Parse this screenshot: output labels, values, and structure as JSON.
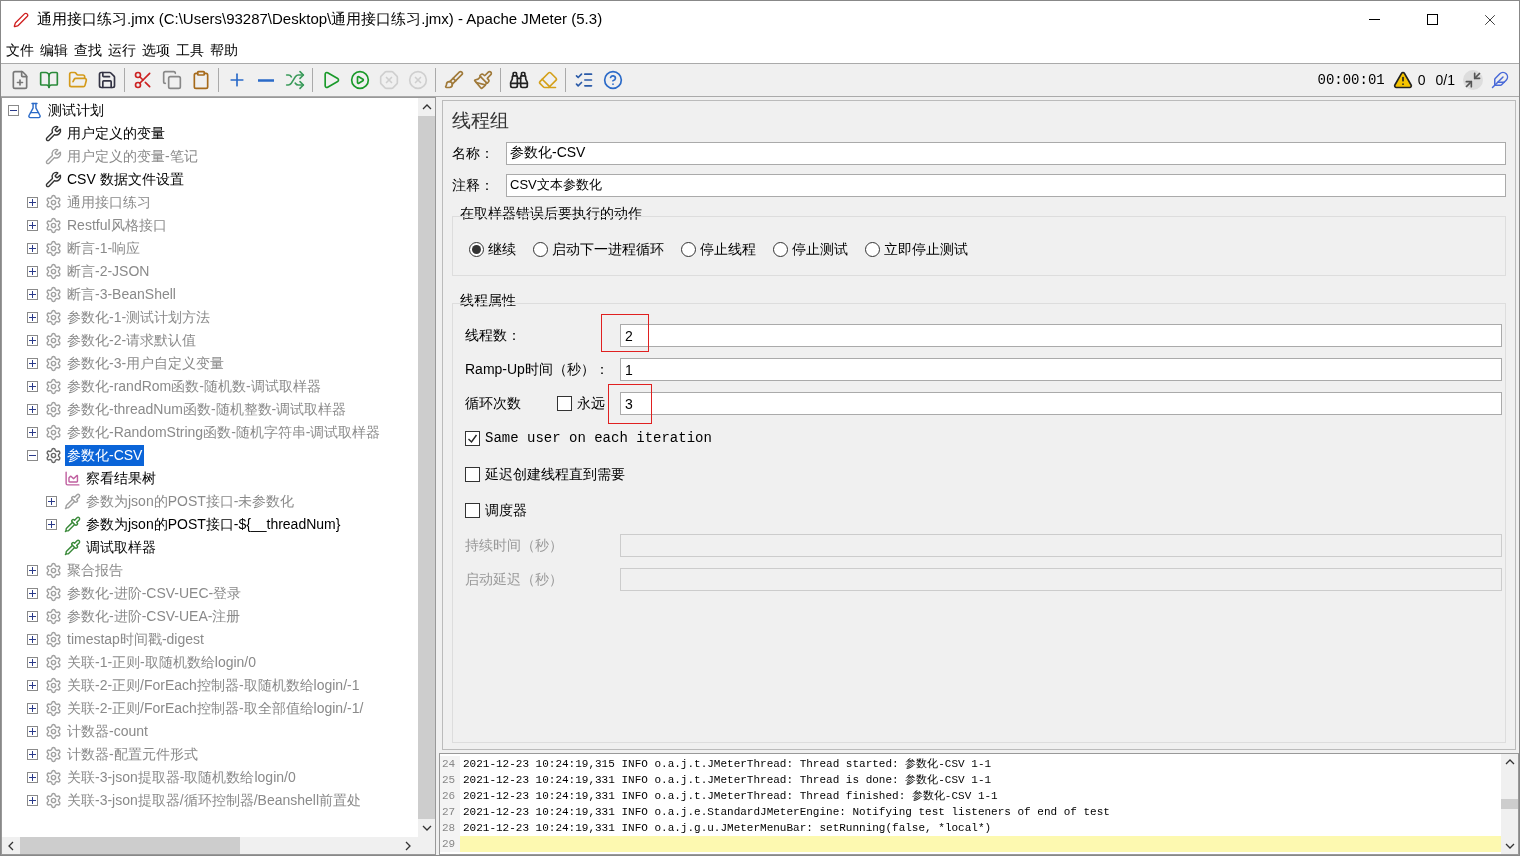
{
  "window": {
    "title": "通用接口练习.jmx (C:\\Users\\93287\\Desktop\\通用接口练习.jmx) - Apache JMeter (5.3)"
  },
  "menu": [
    "文件",
    "编辑",
    "查找",
    "运行",
    "选项",
    "工具",
    "帮助"
  ],
  "toolbar": [
    {
      "kind": "new",
      "disabled": false
    },
    {
      "kind": "templates",
      "disabled": false
    },
    {
      "kind": "open",
      "disabled": false
    },
    {
      "kind": "save",
      "disabled": false
    },
    {
      "kind": "sep"
    },
    {
      "kind": "cut",
      "disabled": false
    },
    {
      "kind": "copy",
      "disabled": false
    },
    {
      "kind": "paste",
      "disabled": false
    },
    {
      "kind": "sep"
    },
    {
      "kind": "expand",
      "disabled": false
    },
    {
      "kind": "collapse",
      "disabled": false
    },
    {
      "kind": "toggle",
      "disabled": false
    },
    {
      "kind": "sep"
    },
    {
      "kind": "start",
      "disabled": false
    },
    {
      "kind": "start-no-pause",
      "disabled": false
    },
    {
      "kind": "stop",
      "disabled": true
    },
    {
      "kind": "shutdown",
      "disabled": true
    },
    {
      "kind": "sep"
    },
    {
      "kind": "clear",
      "disabled": false
    },
    {
      "kind": "clear-all",
      "disabled": false
    },
    {
      "kind": "sep"
    },
    {
      "kind": "search",
      "disabled": false
    },
    {
      "kind": "reset",
      "disabled": false
    },
    {
      "kind": "sep"
    },
    {
      "kind": "functions",
      "disabled": false
    },
    {
      "kind": "help",
      "disabled": false
    }
  ],
  "status": {
    "timer": "00:00:01",
    "warnings": "0",
    "threads": "0/1"
  },
  "tree": [
    {
      "label": "测试计划",
      "kind": "plan",
      "enabled": true,
      "selected": false,
      "expanded": true,
      "children": [
        {
          "label": "用户定义的变量",
          "kind": "config",
          "enabled": true,
          "selected": false
        },
        {
          "label": "用户定义的变量-笔记",
          "kind": "config",
          "enabled": false,
          "selected": false
        },
        {
          "label": "CSV 数据文件设置",
          "kind": "config",
          "enabled": true,
          "selected": false
        },
        {
          "label": "通用接口练习",
          "kind": "threadgroup",
          "enabled": false,
          "selected": false,
          "expanded": false
        },
        {
          "label": "Restful风格接口",
          "kind": "threadgroup",
          "enabled": false,
          "selected": false,
          "expanded": false
        },
        {
          "label": "断言-1-响应",
          "kind": "threadgroup",
          "enabled": false,
          "selected": false,
          "expanded": false
        },
        {
          "label": "断言-2-JSON",
          "kind": "threadgroup",
          "enabled": false,
          "selected": false,
          "expanded": false
        },
        {
          "label": "断言-3-BeanShell",
          "kind": "threadgroup",
          "enabled": false,
          "selected": false,
          "expanded": false
        },
        {
          "label": "参数化-1-测试计划方法",
          "kind": "threadgroup",
          "enabled": false,
          "selected": false,
          "expanded": false
        },
        {
          "label": "参数化-2-请求默认值",
          "kind": "threadgroup",
          "enabled": false,
          "selected": false,
          "expanded": false
        },
        {
          "label": "参数化-3-用户自定义变量",
          "kind": "threadgroup",
          "enabled": false,
          "selected": false,
          "expanded": false
        },
        {
          "label": "参数化-randRom函数-随机数-调试取样器",
          "kind": "threadgroup",
          "enabled": false,
          "selected": false,
          "expanded": false
        },
        {
          "label": "参数化-threadNum函数-随机整数-调试取样器",
          "kind": "threadgroup",
          "enabled": false,
          "selected": false,
          "expanded": false
        },
        {
          "label": "参数化-RandomString函数-随机字符串-调试取样器",
          "kind": "threadgroup",
          "enabled": false,
          "selected": false,
          "expanded": false
        },
        {
          "label": "参数化-CSV",
          "kind": "threadgroup",
          "enabled": true,
          "selected": true,
          "expanded": true,
          "children": [
            {
              "label": "察看结果树",
              "kind": "listener",
              "enabled": true,
              "selected": false
            },
            {
              "label": "参数为json的POST接口-未参数化",
              "kind": "sampler",
              "enabled": false,
              "selected": false,
              "expanded": false
            },
            {
              "label": "参数为json的POST接口-${__threadNum}",
              "kind": "sampler",
              "enabled": true,
              "selected": false,
              "expanded": false
            },
            {
              "label": "调试取样器",
              "kind": "sampler",
              "enabled": true,
              "selected": false
            }
          ]
        },
        {
          "label": "聚合报告",
          "kind": "threadgroup",
          "enabled": false,
          "selected": false,
          "expanded": false
        },
        {
          "label": "参数化-进阶-CSV-UEC-登录",
          "kind": "threadgroup",
          "enabled": false,
          "selected": false,
          "expanded": false
        },
        {
          "label": "参数化-进阶-CSV-UEA-注册",
          "kind": "threadgroup",
          "enabled": false,
          "selected": false,
          "expanded": false
        },
        {
          "label": "timestap时间戳-digest",
          "kind": "threadgroup",
          "enabled": false,
          "selected": false,
          "expanded": false
        },
        {
          "label": "关联-1-正则-取随机数给login/0",
          "kind": "threadgroup",
          "enabled": false,
          "selected": false,
          "expanded": false
        },
        {
          "label": "关联-2-正则/ForEach控制器-取随机数给login/-1",
          "kind": "threadgroup",
          "enabled": false,
          "selected": false,
          "expanded": false
        },
        {
          "label": "关联-2-正则/ForEach控制器-取全部值给login/-1/",
          "kind": "threadgroup",
          "enabled": false,
          "selected": false,
          "expanded": false
        },
        {
          "label": "计数器-count",
          "kind": "threadgroup",
          "enabled": false,
          "selected": false,
          "expanded": false
        },
        {
          "label": "计数器-配置元件形式",
          "kind": "threadgroup",
          "enabled": false,
          "selected": false,
          "expanded": false
        },
        {
          "label": "关联-3-json提取器-取随机数给login/0",
          "kind": "threadgroup",
          "enabled": false,
          "selected": false,
          "expanded": false
        },
        {
          "label": "关联-3-json提取器/循环控制器/Beanshell前置处",
          "kind": "threadgroup",
          "enabled": false,
          "selected": false,
          "expanded": false
        }
      ]
    }
  ],
  "form": {
    "title": "线程组",
    "name_label": "名称：",
    "name_value": "参数化-CSV",
    "comment_label": "注释：",
    "comment_value": "CSV文本参数化",
    "error_action": {
      "legend": "在取样器错误后要执行的动作",
      "options": [
        {
          "label": "继续",
          "selected": true
        },
        {
          "label": "启动下一进程循环",
          "selected": false
        },
        {
          "label": "停止线程",
          "selected": false
        },
        {
          "label": "停止测试",
          "selected": false
        },
        {
          "label": "立即停止测试",
          "selected": false
        }
      ]
    },
    "thread_props": {
      "legend": "线程属性",
      "threads_label": "线程数：",
      "threads_value": "2",
      "threads_highlighted": true,
      "rampup_label": "Ramp-Up时间（秒）：",
      "rampup_value": "1",
      "loop_label": "循环次数",
      "forever": {
        "label": "永远",
        "checked": false
      },
      "loop_value": "3",
      "loop_highlighted": true,
      "checks": [
        {
          "label": "Same user on each iteration",
          "checked": true,
          "mono": true
        },
        {
          "label": "延迟创建线程直到需要",
          "checked": false,
          "mono": false
        },
        {
          "label": "调度器",
          "checked": false,
          "mono": false
        }
      ],
      "duration_label": "持续时间（秒）",
      "delay_label": "启动延迟（秒）",
      "scheduler_fields_disabled": true
    }
  },
  "log": [
    {
      "line": "24",
      "text": "2021-12-23 10:24:19,315 INFO o.a.j.t.JMeterThread: Thread started: 参数化-CSV 1-1"
    },
    {
      "line": "25",
      "text": "2021-12-23 10:24:19,331 INFO o.a.j.t.JMeterThread: Thread is done: 参数化-CSV 1-1"
    },
    {
      "line": "26",
      "text": "2021-12-23 10:24:19,331 INFO o.a.j.t.JMeterThread: Thread finished: 参数化-CSV 1-1"
    },
    {
      "line": "27",
      "text": "2021-12-23 10:24:19,331 INFO o.a.j.e.StandardJMeterEngine: Notifying test listeners of end of test"
    },
    {
      "line": "28",
      "text": "2021-12-23 10:24:19,331 INFO o.a.j.g.u.JMeterMenuBar: setRunning(false, *local*)"
    },
    {
      "line": "29",
      "current": true
    }
  ]
}
